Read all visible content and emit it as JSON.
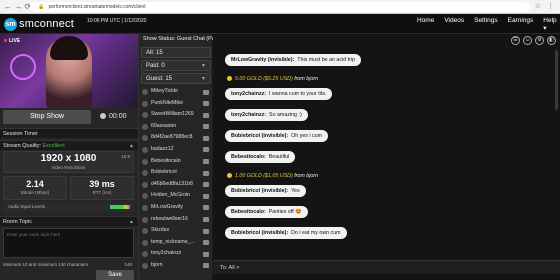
{
  "browser": {
    "url": "performerclient.streamatemodels.com/client",
    "controls": "← → ⟳",
    "toolbar_icons": "☆ ⋮"
  },
  "header": {
    "logo_mark": "sm",
    "logo_text": "smconnect",
    "clock": "10:06 PM UTC | 1/12/2020",
    "nav": [
      "Home",
      "Videos",
      "Settings",
      "Earnings",
      "Help ▾"
    ]
  },
  "broadcast": {
    "live_label": "LIVE",
    "stop_label": "Stop Show",
    "timer": "00:00",
    "session_timer_label": "Session Timer",
    "stream_quality_label": "Stream Quality:",
    "stream_quality_value": "Excellent",
    "resolution": "1920 x 1080",
    "resolution_label": "Video Resolution",
    "aspect": "16:9",
    "bitrate": "2.14",
    "bitrate_label": "Bitrate (Mbps)",
    "rtt": "39 ms",
    "rtt_label": "RTT (ms)",
    "audio_label": "Audio Input Levels",
    "room_topic_label": "Room Topic",
    "room_topic_placeholder": "Enter your room topic here",
    "topic_hint": "Minimum 10 and maximum 140 characters",
    "topic_count": "140",
    "save_label": "Save"
  },
  "users": {
    "status": "Show Status: Guest Chat (Party Mode)",
    "all_label": "All: 15",
    "paid_label": "Paid: 0",
    "guest_label": "Guest: 15",
    "list": [
      "MikeyTickle",
      "PunkNiteMike",
      "SweetWilliam1269",
      "69assaster",
      "8d4f2ae87988ec8",
      "badazz12",
      "Bebesitocalo",
      "Bobiebricol",
      "d46b6ed8fa131b8",
      "Holden_McGroin",
      "MrLowGravity",
      "reboutwelloer16",
      "Skizdax",
      "temp_nickname_...",
      "tony2chainzz",
      "bjorn"
    ]
  },
  "chat": {
    "icons": [
      "☰",
      "☺",
      "⚙",
      "◧"
    ],
    "messages": [
      {
        "kind": "msg",
        "user": "MrLowGravity (invisible):",
        "text": "This must be an acid trip"
      },
      {
        "kind": "tip",
        "amount": "5.00 GOLD ($5.25 USD)",
        "from": "from bjorn"
      },
      {
        "kind": "msg",
        "user": "tony2chainzz:",
        "text": "I wanna cum to your tits."
      },
      {
        "kind": "msg",
        "user": "tony2chainzz:",
        "text": "So amazing :)"
      },
      {
        "kind": "msg",
        "user": "Bobiebricol (invisible):",
        "text": "Oh yes i cum"
      },
      {
        "kind": "msg",
        "user": "Bebesitocalo:",
        "text": "Beautiful"
      },
      {
        "kind": "tip",
        "amount": "1.00 GOLD ($1.05 USD)",
        "from": "from bjorn"
      },
      {
        "kind": "msg",
        "user": "Bobiebricol (invisible):",
        "text": "Yes"
      },
      {
        "kind": "msg",
        "user": "Bebesitocalo:",
        "text": "Panties off 😍"
      },
      {
        "kind": "msg",
        "user": "Bobiebricol (invisible):",
        "text": "Do i eat my own cum"
      }
    ],
    "input_label": "To: All >"
  }
}
